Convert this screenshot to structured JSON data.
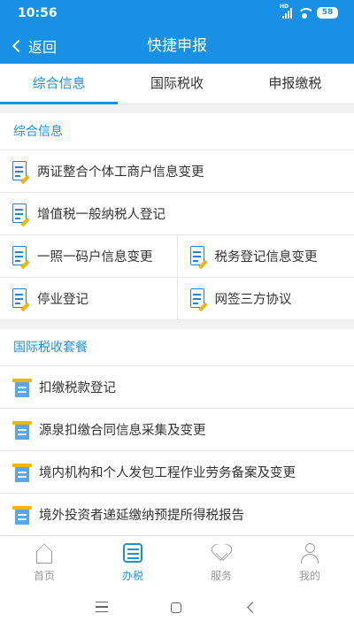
{
  "status_bar": {
    "time": "10:56",
    "network_label": "HD",
    "battery": "58"
  },
  "header": {
    "back_label": "返回",
    "title": "快捷申报"
  },
  "tabs": [
    {
      "label": "综合信息",
      "active": true
    },
    {
      "label": "国际税收",
      "active": false
    },
    {
      "label": "申报缴税",
      "active": false
    }
  ],
  "sections": {
    "general": {
      "title": "综合信息",
      "items": [
        "两证整合个体工商户信息变更",
        "增值税一般纳税人登记",
        "一照一码户信息变更",
        "税务登记信息变更",
        "停业登记",
        "网签三方协议"
      ]
    },
    "international": {
      "title": "国际税收套餐",
      "items": [
        "扣缴税款登记",
        "源泉扣缴合同信息采集及变更",
        "境内机构和个人发包工程作业劳务备案及变更",
        "境外投资者递延缴纳预提所得税报告"
      ]
    }
  },
  "bottom_nav": [
    {
      "label": "首页",
      "icon": "home-icon",
      "active": false
    },
    {
      "label": "办税",
      "icon": "list-icon",
      "active": true
    },
    {
      "label": "服务",
      "icon": "heart-icon",
      "active": false
    },
    {
      "label": "我的",
      "icon": "user-icon",
      "active": false
    }
  ],
  "colors": {
    "brand": "#1890e6",
    "doc_icon": "#2e7fd8",
    "pen": "#f2b705",
    "inactive": "#999999"
  }
}
